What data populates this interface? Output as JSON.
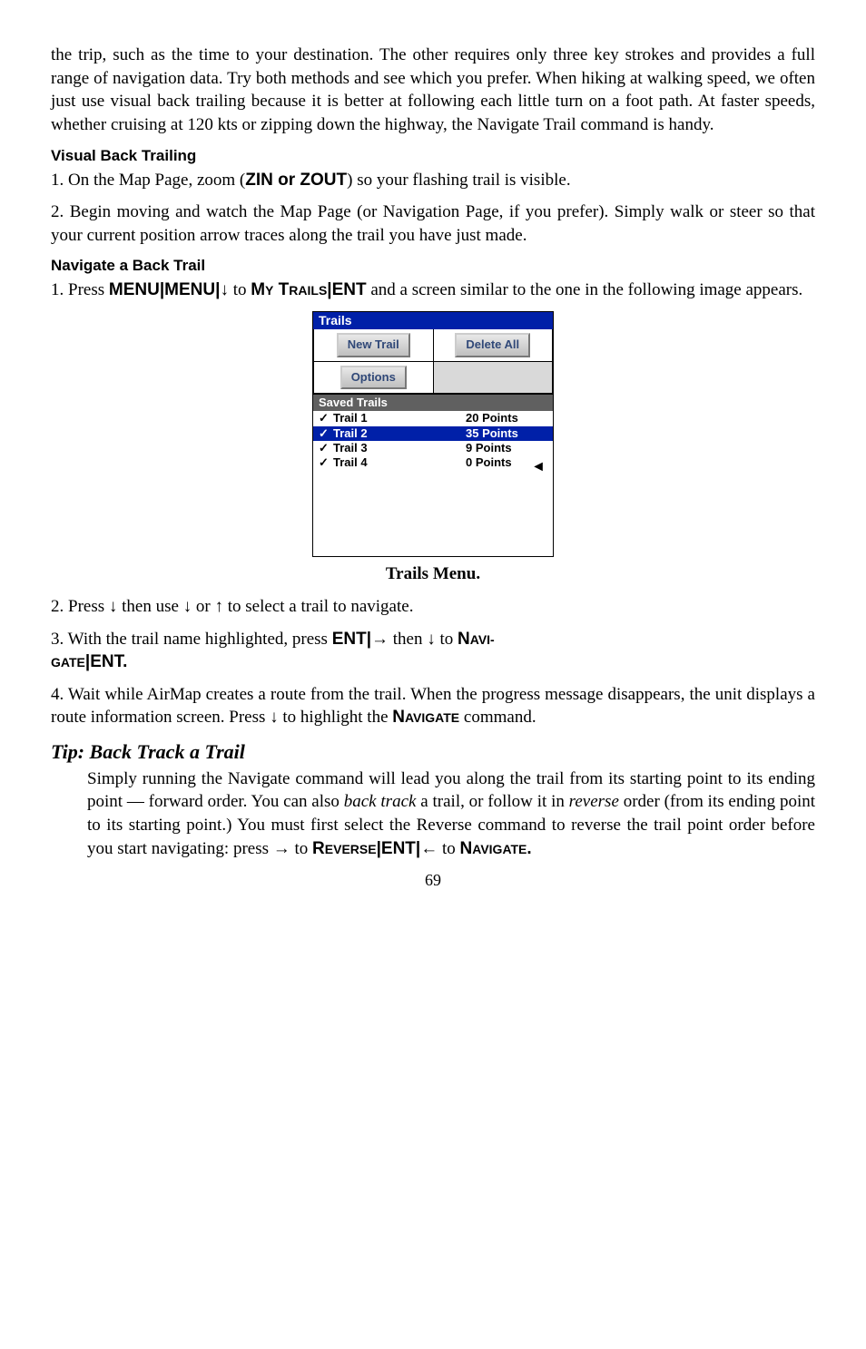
{
  "para1": "the trip, such as the time to your destination. The other requires only three key strokes and provides a full range of navigation data. Try both methods and see which you prefer. When hiking at walking speed, we often just use visual back trailing because it is better at following each little turn on a foot path. At faster speeds, whether cruising at 120 kts or zipping down the highway, the Navigate Trail command is handy.",
  "hdr_vbt": "Visual Back Trailing",
  "vbt_1a": "1. On the Map Page, zoom (",
  "zin": "ZIN",
  "or": " or ",
  "zout": "ZOUT",
  "vbt_1b": ") so your flashing trail is visible.",
  "vbt_2": "2. Begin moving and watch the Map Page (or Navigation Page, if you prefer). Simply walk or steer so that your current position arrow traces along the trail you have just made.",
  "hdr_nbt": "Navigate a Back Trail",
  "nbt_1a": "1. Press ",
  "menu": "MENU",
  "pipe": "|",
  "down": "↓",
  "to_sp": " to ",
  "mytrails_pre": "M",
  "mytrails_rest": "Y",
  "trails_pre": " T",
  "trails_rest": "RAILS",
  "ent": "ENT",
  "nbt_1b": " and a screen similar to the one in the following image appears.",
  "shot": {
    "title": "Trails",
    "btn_new": "New Trail",
    "btn_del": "Delete All",
    "btn_opt": "Options",
    "sub": "Saved Trails",
    "rows": [
      {
        "chk": "✓",
        "name": "Trail 1",
        "pts": "20 Points",
        "sel": false
      },
      {
        "chk": "✓",
        "name": "Trail 2",
        "pts": "35 Points",
        "sel": true
      },
      {
        "chk": "✓",
        "name": "Trail 3",
        "pts": "9 Points",
        "sel": false
      },
      {
        "chk": "✓",
        "name": "Trail 4",
        "pts": "0 Points",
        "sel": false
      }
    ],
    "arrow": "◄"
  },
  "caption": "Trails Menu.",
  "step2a": "2. Press ",
  "step2b": " then use ",
  "step2c": " or ",
  "up": "↑",
  "step2d": " to select a trail to navigate.",
  "step3a": "3. With the trail name highlighted, press ",
  "right": "→",
  "then_sp": " then ",
  "navi_pre": "N",
  "navi_rest": "AVI-",
  "gate_rest": "GATE",
  "period": ".",
  "step4": "4. Wait while AirMap creates a route from the trail. When the progress message disappears, the unit displays a route information screen. Press ",
  "step4b": " to highlight the ",
  "navigate_pre": "N",
  "navigate_rest": "AVIGATE",
  "step4c": " command.",
  "tip_hdr": "Tip: Back Track a Trail",
  "tip_body1": "Simply running the Navigate command will lead you along the trail from its starting point to its ending point — forward order. You can also ",
  "backtrack": "back track",
  "tip_body2": " a trail, or follow it in ",
  "reverse_it": "reverse",
  "tip_body3": " order (from its ending point to its starting point.) You must first select the Reverse command to reverse the trail point order before you start navigating: press ",
  "tip_to": " to ",
  "reverse_pre": "R",
  "reverse_rest": "EVERSE",
  "left": "←",
  "pagenum": "69"
}
